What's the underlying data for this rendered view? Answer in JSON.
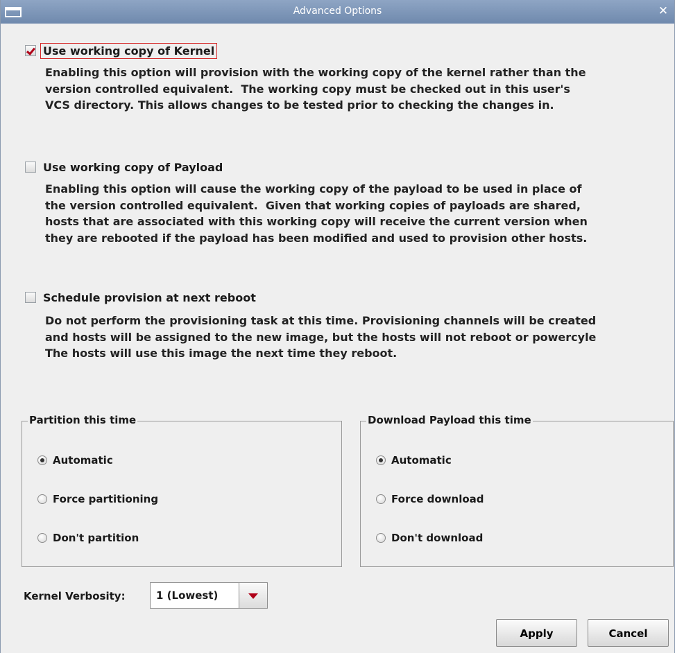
{
  "window": {
    "title": "Advanced Options",
    "close_glyph": "✕"
  },
  "options": [
    {
      "label": "Use working copy of Kernel",
      "checked": true,
      "description": "Enabling this option will provision with the working copy of the kernel rather than the\nversion controlled equivalent.  The working copy must be checked out in this user's\nVCS directory. This allows changes to be tested prior to checking the changes in."
    },
    {
      "label": "Use working copy of Payload",
      "checked": false,
      "description": "Enabling this option will cause the working copy of the payload to be used in place of\nthe version controlled equivalent.  Given that working copies of payloads are shared,\nhosts that are associated with this working copy will receive the current version when\nthey are rebooted if the payload has been modified and used to provision other hosts."
    },
    {
      "label": "Schedule provision at next reboot",
      "checked": false,
      "description": "Do not perform the provisioning task at this time. Provisioning channels will be created\nand hosts will be assigned to the new image, but the hosts will not reboot or powercyle\nThe hosts will use this image the next time they reboot."
    }
  ],
  "partition_group": {
    "title": "Partition this time",
    "options": [
      "Automatic",
      "Force partitioning",
      "Don't partition"
    ],
    "selected": "Automatic"
  },
  "download_group": {
    "title": "Download Payload this time",
    "options": [
      "Automatic",
      "Force download",
      "Don't download"
    ],
    "selected": "Automatic"
  },
  "verbosity": {
    "label": "Kernel Verbosity:",
    "value": "1 (Lowest)"
  },
  "buttons": {
    "apply": "Apply",
    "cancel": "Cancel"
  },
  "colors": {
    "titlebar": "#7f97b9",
    "accent_red": "#b00018",
    "focus_border": "#d52a2a"
  },
  "icons": {
    "window": "window-icon",
    "close": "close-icon",
    "check": "checkmark-icon",
    "dropdown": "triangle-down-icon"
  }
}
